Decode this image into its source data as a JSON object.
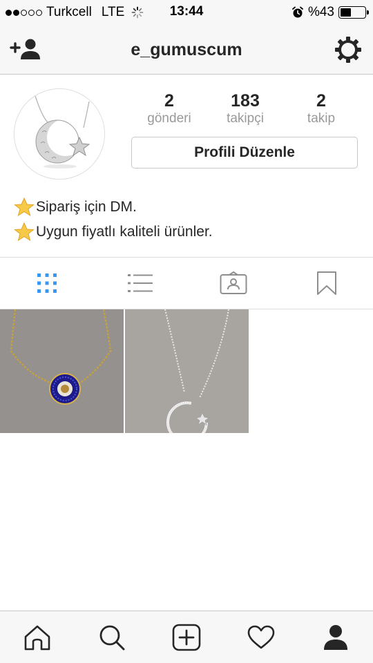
{
  "status_bar": {
    "carrier": "Turkcell",
    "network": "LTE",
    "time": "13:44",
    "battery_text": "%43",
    "battery_level": 0.43,
    "signal_bars_filled": 2,
    "signal_bars_total": 5
  },
  "nav": {
    "username": "e_gumuscum",
    "left_icon": "add-user-icon",
    "right_icon": "gear-icon"
  },
  "profile": {
    "stats": [
      {
        "value": "2",
        "label": "gönderi"
      },
      {
        "value": "183",
        "label": "takipçi"
      },
      {
        "value": "2",
        "label": "takip"
      }
    ],
    "edit_button": "Profili Düzenle",
    "bio": [
      {
        "icon": "star-emoji",
        "text": "Sipariş için DM."
      },
      {
        "icon": "star-emoji",
        "text": "Uygun fiyatlı kaliteli ürünler."
      }
    ]
  },
  "tabs": [
    {
      "icon": "grid-icon",
      "active": true
    },
    {
      "icon": "list-icon",
      "active": false
    },
    {
      "icon": "tagged-icon",
      "active": false
    },
    {
      "icon": "bookmark-icon",
      "active": false
    }
  ],
  "posts": [
    {
      "icon": "evil-eye-necklace-photo"
    },
    {
      "icon": "crescent-necklace-photo"
    }
  ],
  "bottom_bar": [
    {
      "icon": "home-icon"
    },
    {
      "icon": "search-icon"
    },
    {
      "icon": "add-post-icon"
    },
    {
      "icon": "heart-icon"
    },
    {
      "icon": "profile-icon",
      "active": true
    }
  ],
  "colors": {
    "accent": "#3897f0",
    "text": "#262626",
    "muted": "#999999",
    "bar_bg": "#f7f7f7",
    "border": "#c7c7c7",
    "star": "#f7c948"
  }
}
